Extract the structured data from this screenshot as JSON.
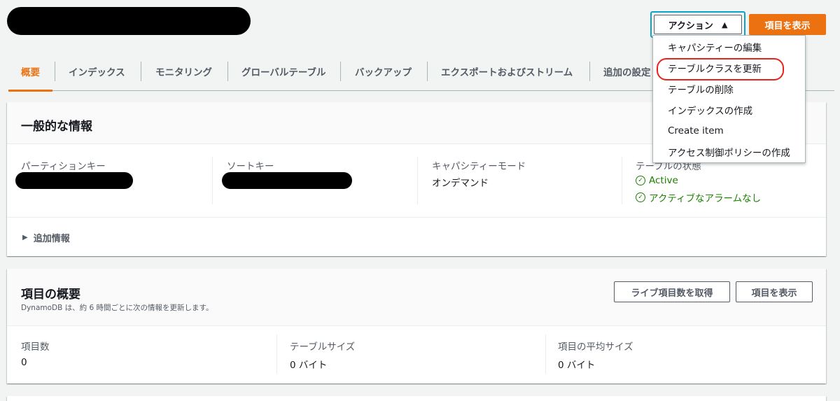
{
  "header": {
    "actions_label": "アクション",
    "primary_label": "項目を表示"
  },
  "tabs": [
    {
      "label": "概要",
      "active": true
    },
    {
      "label": "インデックス"
    },
    {
      "label": "モニタリング"
    },
    {
      "label": "グローバルテーブル"
    },
    {
      "label": "バックアップ"
    },
    {
      "label": "エクスポートおよびストリーム"
    },
    {
      "label": "追加の設定"
    }
  ],
  "general": {
    "title": "一般的な情報",
    "partition_key_label": "パーティションキー",
    "sort_key_label": "ソートキー",
    "capacity_mode_label": "キャパシティーモード",
    "capacity_mode_value": "オンデマンド",
    "table_status_label": "テーブルの状態",
    "status_active": "Active",
    "status_alarms": "アクティブなアラームなし",
    "additional_info": "追加情報"
  },
  "items_summary": {
    "title": "項目の概要",
    "subtitle": "DynamoDB は、約 6 時間ごとに次の情報を更新します。",
    "get_live_count": "ライブ項目数を取得",
    "view_items": "項目を表示",
    "item_count_label": "項目数",
    "item_count_value": "0",
    "table_size_label": "テーブルサイズ",
    "table_size_value": "0 バイト",
    "avg_size_label": "項目の平均サイズ",
    "avg_size_value": "0 バイト"
  },
  "actions_menu": [
    {
      "label": "キャパシティーの編集"
    },
    {
      "label": "テーブルクラスを更新",
      "highlighted": true
    },
    {
      "label": "テーブルの削除"
    },
    {
      "label": "インデックスの作成"
    },
    {
      "label": "Create item"
    },
    {
      "label": "アクセス制御ポリシーの作成"
    }
  ],
  "colors": {
    "accent": "#ec7211",
    "success": "#1d8102",
    "highlight_ring": "#e8231c",
    "focus_ring": "#0aa4c8"
  }
}
